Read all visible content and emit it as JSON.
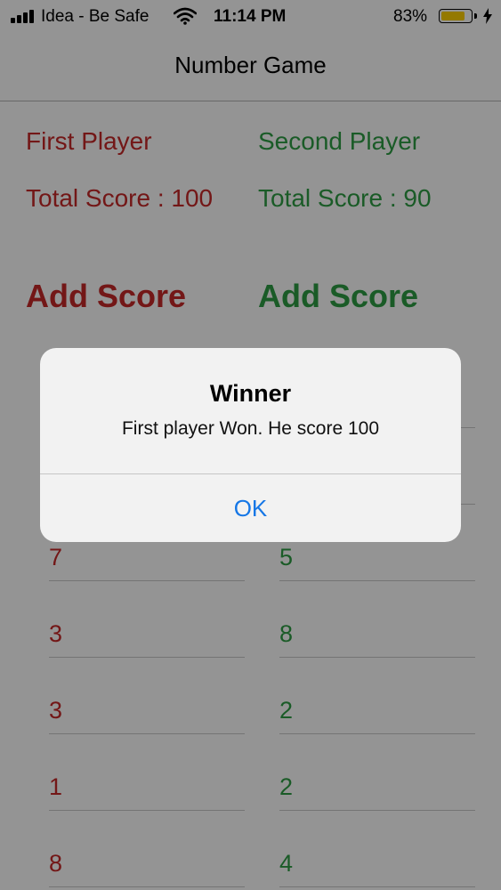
{
  "status_bar": {
    "carrier": "Idea - Be Safe",
    "time": "11:14 PM",
    "battery_percent": "83%",
    "battery_level": 0.83,
    "icons": [
      "signal-icon",
      "wifi-icon",
      "battery-icon",
      "charging-bolt-icon"
    ]
  },
  "nav": {
    "title": "Number Game"
  },
  "players": [
    {
      "name": "First Player",
      "total_score": "Total Score : 100",
      "add_score_label": "Add Score",
      "color": "#c62828",
      "scores": [
        "",
        "",
        "7",
        "3",
        "3",
        "1",
        "8"
      ]
    },
    {
      "name": "Second Player",
      "total_score": "Total Score : 90",
      "add_score_label": "Add Score",
      "color": "#2e9e44",
      "scores": [
        "",
        "",
        "5",
        "8",
        "2",
        "2",
        "4"
      ]
    }
  ],
  "alert": {
    "title": "Winner",
    "message": "First player Won. He score 100",
    "button_label": "OK"
  }
}
